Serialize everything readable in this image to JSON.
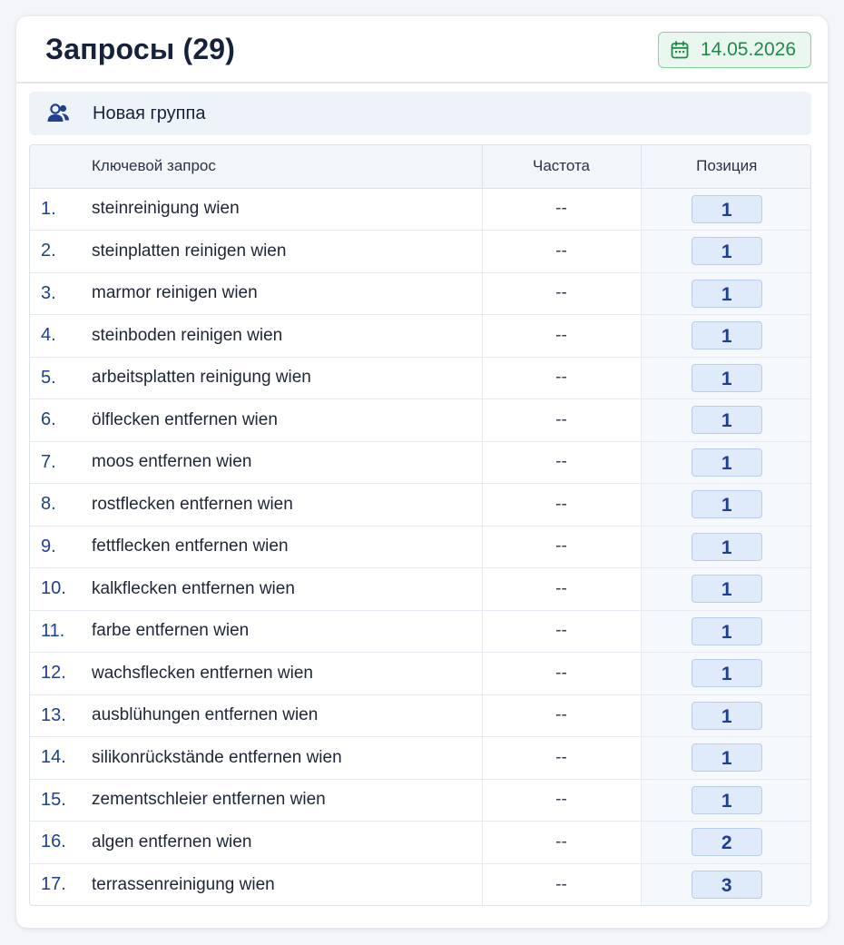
{
  "header": {
    "title": "Запросы (29)",
    "date": "14.05.2026",
    "date_icon": "calendar-icon"
  },
  "group": {
    "icon": "users-icon",
    "name": "Новая группа"
  },
  "colors": {
    "accent_blue": "#1f3f8f",
    "date_green": "#1f8a4a",
    "date_bg": "#eaf7ef",
    "badge_bg": "#dfeafb"
  },
  "table": {
    "columns": {
      "keyword": "Ключевой запрос",
      "frequency": "Частота",
      "position": "Позиция"
    },
    "rows": [
      {
        "num": "1.",
        "keyword": "steinreinigung wien",
        "frequency": "--",
        "position": "1"
      },
      {
        "num": "2.",
        "keyword": "steinplatten reinigen wien",
        "frequency": "--",
        "position": "1"
      },
      {
        "num": "3.",
        "keyword": "marmor reinigen wien",
        "frequency": "--",
        "position": "1"
      },
      {
        "num": "4.",
        "keyword": "steinboden reinigen wien",
        "frequency": "--",
        "position": "1"
      },
      {
        "num": "5.",
        "keyword": "arbeitsplatten reinigung wien",
        "frequency": "--",
        "position": "1"
      },
      {
        "num": "6.",
        "keyword": "ölflecken entfernen wien",
        "frequency": "--",
        "position": "1"
      },
      {
        "num": "7.",
        "keyword": "moos entfernen wien",
        "frequency": "--",
        "position": "1"
      },
      {
        "num": "8.",
        "keyword": "rostflecken entfernen wien",
        "frequency": "--",
        "position": "1"
      },
      {
        "num": "9.",
        "keyword": "fettflecken entfernen wien",
        "frequency": "--",
        "position": "1"
      },
      {
        "num": "10.",
        "keyword": "kalkflecken entfernen wien",
        "frequency": "--",
        "position": "1"
      },
      {
        "num": "11.",
        "keyword": "farbe entfernen wien",
        "frequency": "--",
        "position": "1"
      },
      {
        "num": "12.",
        "keyword": "wachsflecken entfernen wien",
        "frequency": "--",
        "position": "1"
      },
      {
        "num": "13.",
        "keyword": "ausblühungen entfernen wien",
        "frequency": "--",
        "position": "1"
      },
      {
        "num": "14.",
        "keyword": "silikonrückstände entfernen wien",
        "frequency": "--",
        "position": "1"
      },
      {
        "num": "15.",
        "keyword": "zementschleier entfernen wien",
        "frequency": "--",
        "position": "1"
      },
      {
        "num": "16.",
        "keyword": "algen entfernen wien",
        "frequency": "--",
        "position": "2"
      },
      {
        "num": "17.",
        "keyword": "terrassenreinigung wien",
        "frequency": "--",
        "position": "3"
      }
    ]
  }
}
